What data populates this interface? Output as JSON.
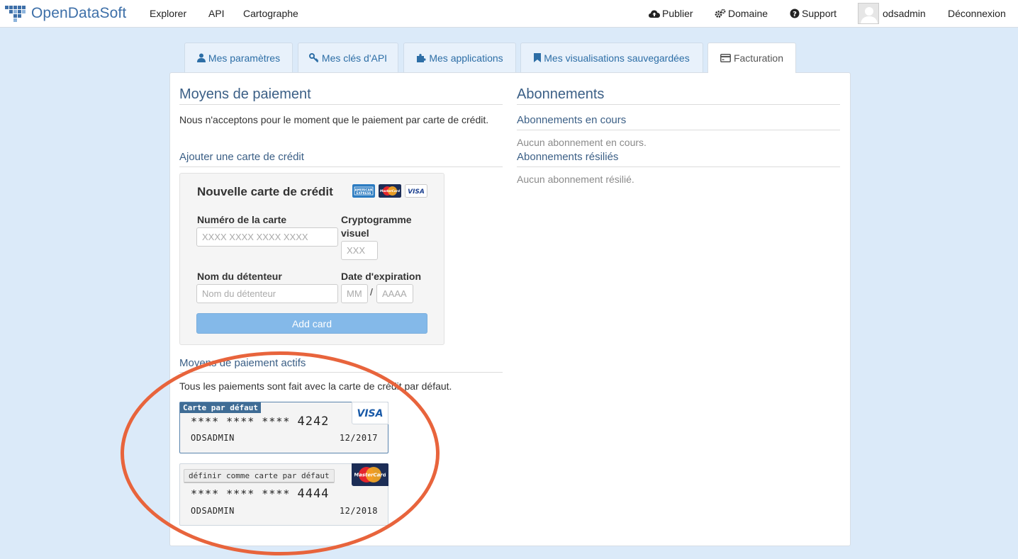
{
  "nav": {
    "brand": "OpenDataSoft",
    "links": [
      "Explorer",
      "API",
      "Cartographe"
    ],
    "publish": "Publier",
    "domain": "Domaine",
    "support": "Support",
    "username": "odsadmin",
    "logout": "Déconnexion"
  },
  "tabs": [
    {
      "label": "Mes paramètres",
      "icon": "user-icon"
    },
    {
      "label": "Mes clés d'API",
      "icon": "key-icon"
    },
    {
      "label": "Mes applications",
      "icon": "puzzle-icon"
    },
    {
      "label": "Mes visualisations sauvegardées",
      "icon": "bookmark-icon"
    },
    {
      "label": "Facturation",
      "icon": "credit-card-icon",
      "active": true
    }
  ],
  "payment": {
    "title": "Moyens de paiement",
    "intro": "Nous n'acceptons pour le moment que le paiement par carte de crédit.",
    "add_title": "Ajouter une carte de crédit",
    "form": {
      "title": "Nouvelle carte de crédit",
      "logos": [
        "AMERICAN EXPRESS",
        "MasterCard",
        "VISA"
      ],
      "card_number_label": "Numéro de la carte",
      "card_number_placeholder": "XXXX XXXX XXXX XXXX",
      "cvc_label": "Cryptogramme visuel",
      "cvc_placeholder": "XXX",
      "holder_label": "Nom du détenteur",
      "holder_placeholder": "Nom du détenteur",
      "expiry_label": "Date d'expiration",
      "month_placeholder": "MM",
      "year_placeholder": "AAAA",
      "separator": "/",
      "submit": "Add card"
    },
    "active_title": "Moyens de paiement actifs",
    "active_note": "Tous les paiements sont fait avec la carte de crédit par défaut.",
    "cards": [
      {
        "badge": "Carte par défaut",
        "masked": "**** **** ****",
        "last4": "4242",
        "holder": "ODSADMIN",
        "expiry": "12/2017",
        "brand": "VISA"
      },
      {
        "action": "définir comme carte par défaut",
        "masked": "**** **** ****",
        "last4": "4444",
        "holder": "ODSADMIN",
        "expiry": "12/2018",
        "brand": "MasterCard"
      }
    ]
  },
  "subscriptions": {
    "title": "Abonnements",
    "current_title": "Abonnements en cours",
    "current_empty": "Aucun abonnement en cours.",
    "cancelled_title": "Abonnements résiliés",
    "cancelled_empty": "Aucun abonnement résilié."
  },
  "colors": {
    "accent": "#2d6ea6",
    "heading": "#3b5f86",
    "button": "#84b9e9",
    "annotation": "#e8643c"
  }
}
